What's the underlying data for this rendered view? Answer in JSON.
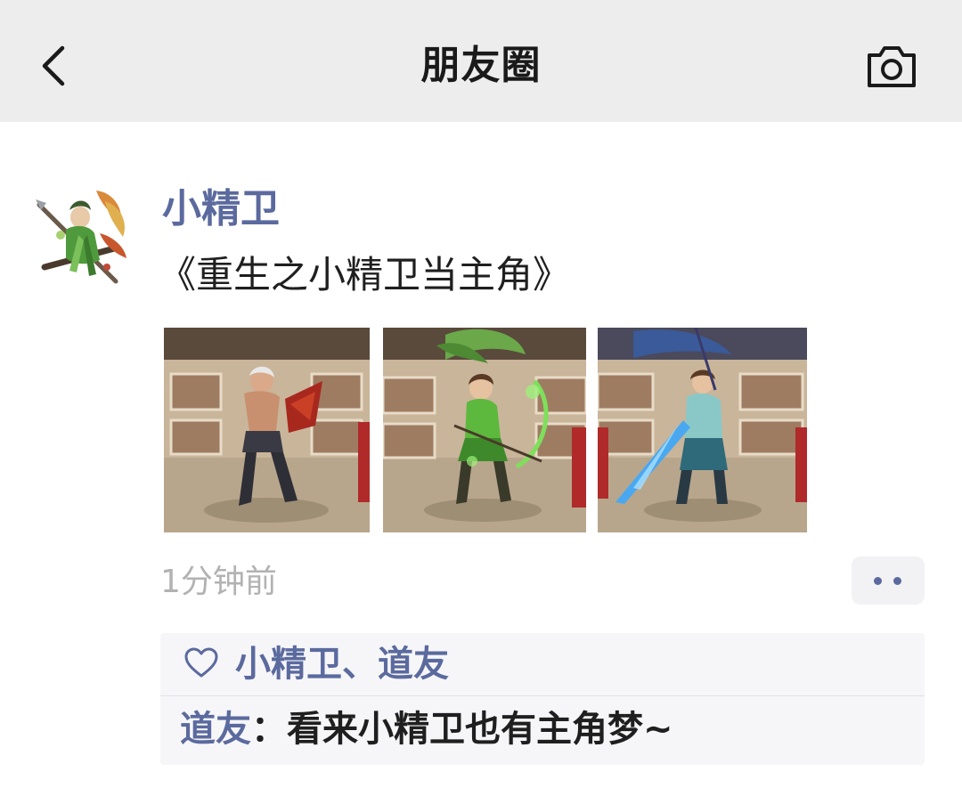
{
  "header": {
    "title": "朋友圈",
    "back_icon": "chevron-left-icon",
    "camera_icon": "camera-icon"
  },
  "post": {
    "author": "小精卫",
    "text": "《重生之小精卫当主角》",
    "photos": [
      "hero-bare-chest-warrior",
      "hero-green-archer",
      "hero-blue-swordsman"
    ],
    "timestamp": "1分钟前"
  },
  "likes": {
    "names": "小精卫、道友"
  },
  "comments": [
    {
      "author": "道友",
      "separator": "：",
      "text": "看来小精卫也有主角梦~"
    }
  ],
  "colors": {
    "header_bg": "#ededed",
    "link": "#5b6a9e",
    "muted": "#b2b2b2",
    "panel_bg": "#f6f6f8"
  }
}
